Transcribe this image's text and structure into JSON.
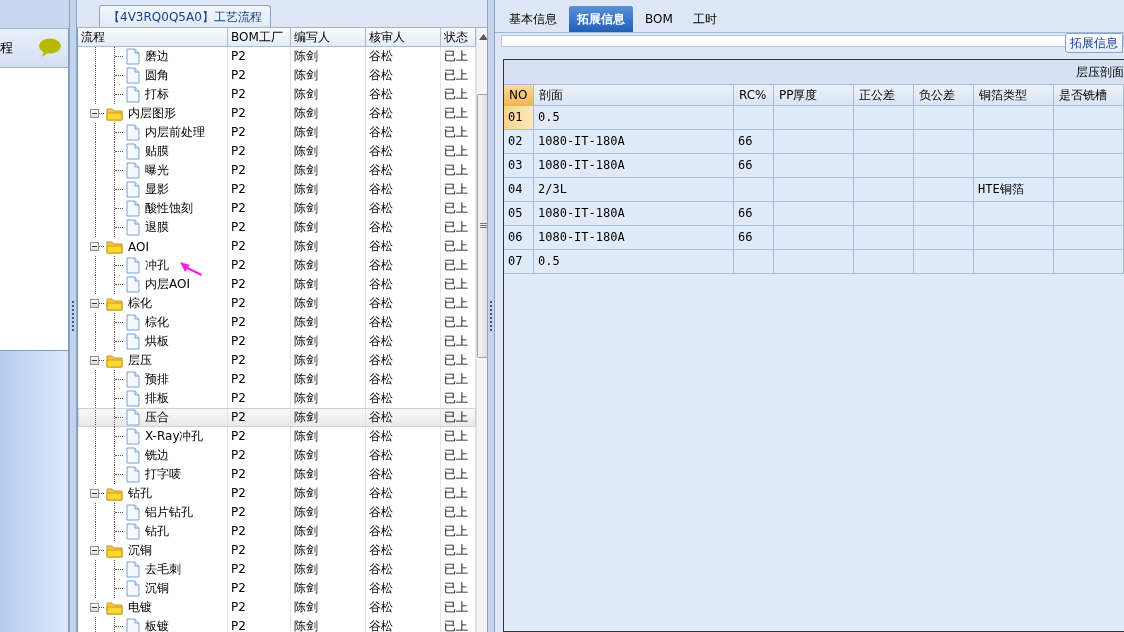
{
  "left_panel": {
    "title": "程"
  },
  "process_panel": {
    "title": "【4V3RQ0Q5A0】工艺流程",
    "columns": [
      "流程",
      "BOM工厂",
      "编写人",
      "核审人",
      "状态"
    ],
    "tree": [
      {
        "children": [
          {
            "name": "磨边",
            "bom": "P2",
            "writer": "陈剑",
            "reviewer": "谷松",
            "status": "已上",
            "selected": false
          },
          {
            "name": "圆角",
            "bom": "P2",
            "writer": "陈剑",
            "reviewer": "谷松",
            "status": "已上",
            "selected": false
          },
          {
            "name": "打标",
            "bom": "P2",
            "writer": "陈剑",
            "reviewer": "谷松",
            "status": "已上",
            "selected": false
          }
        ]
      },
      {
        "name": "内层图形",
        "bom": "P2",
        "writer": "陈剑",
        "reviewer": "谷松",
        "status": "已上",
        "selected": false,
        "expanded": true,
        "children": [
          {
            "name": "内层前处理",
            "bom": "P2",
            "writer": "陈剑",
            "reviewer": "谷松",
            "status": "已上",
            "selected": false
          },
          {
            "name": "贴膜",
            "bom": "P2",
            "writer": "陈剑",
            "reviewer": "谷松",
            "status": "已上",
            "selected": false
          },
          {
            "name": "曝光",
            "bom": "P2",
            "writer": "陈剑",
            "reviewer": "谷松",
            "status": "已上",
            "selected": false
          },
          {
            "name": "显影",
            "bom": "P2",
            "writer": "陈剑",
            "reviewer": "谷松",
            "status": "已上",
            "selected": false
          },
          {
            "name": "酸性蚀刻",
            "bom": "P2",
            "writer": "陈剑",
            "reviewer": "谷松",
            "status": "已上",
            "selected": false
          },
          {
            "name": "退膜",
            "bom": "P2",
            "writer": "陈剑",
            "reviewer": "谷松",
            "status": "已上",
            "selected": false
          }
        ]
      },
      {
        "name": "AOI",
        "bom": "P2",
        "writer": "陈剑",
        "reviewer": "谷松",
        "status": "已上",
        "selected": false,
        "expanded": true,
        "children": [
          {
            "name": "冲孔",
            "bom": "P2",
            "writer": "陈剑",
            "reviewer": "谷松",
            "status": "已上",
            "selected": false
          },
          {
            "name": "内层AOI",
            "bom": "P2",
            "writer": "陈剑",
            "reviewer": "谷松",
            "status": "已上",
            "selected": false
          }
        ]
      },
      {
        "name": "棕化",
        "bom": "P2",
        "writer": "陈剑",
        "reviewer": "谷松",
        "status": "已上",
        "selected": false,
        "expanded": true,
        "children": [
          {
            "name": "棕化",
            "bom": "P2",
            "writer": "陈剑",
            "reviewer": "谷松",
            "status": "已上",
            "selected": false
          },
          {
            "name": "烘板",
            "bom": "P2",
            "writer": "陈剑",
            "reviewer": "谷松",
            "status": "已上",
            "selected": false
          }
        ]
      },
      {
        "name": "层压",
        "bom": "P2",
        "writer": "陈剑",
        "reviewer": "谷松",
        "status": "已上",
        "selected": false,
        "expanded": true,
        "children": [
          {
            "name": "预排",
            "bom": "P2",
            "writer": "陈剑",
            "reviewer": "谷松",
            "status": "已上",
            "selected": false
          },
          {
            "name": "排板",
            "bom": "P2",
            "writer": "陈剑",
            "reviewer": "谷松",
            "status": "已上",
            "selected": false
          },
          {
            "name": "压合",
            "bom": "P2",
            "writer": "陈剑",
            "reviewer": "谷松",
            "status": "已上",
            "selected": true
          },
          {
            "name": "X-Ray冲孔",
            "bom": "P2",
            "writer": "陈剑",
            "reviewer": "谷松",
            "status": "已上",
            "selected": false
          },
          {
            "name": "铣边",
            "bom": "P2",
            "writer": "陈剑",
            "reviewer": "谷松",
            "status": "已上",
            "selected": false
          },
          {
            "name": "打字唛",
            "bom": "P2",
            "writer": "陈剑",
            "reviewer": "谷松",
            "status": "已上",
            "selected": false
          }
        ]
      },
      {
        "name": "钻孔",
        "bom": "P2",
        "writer": "陈剑",
        "reviewer": "谷松",
        "status": "已上",
        "selected": false,
        "expanded": true,
        "children": [
          {
            "name": "铝片钻孔",
            "bom": "P2",
            "writer": "陈剑",
            "reviewer": "谷松",
            "status": "已上",
            "selected": false
          },
          {
            "name": "钻孔",
            "bom": "P2",
            "writer": "陈剑",
            "reviewer": "谷松",
            "status": "已上",
            "selected": false
          }
        ]
      },
      {
        "name": "沉铜",
        "bom": "P2",
        "writer": "陈剑",
        "reviewer": "谷松",
        "status": "已上",
        "selected": false,
        "expanded": true,
        "children": [
          {
            "name": "去毛刺",
            "bom": "P2",
            "writer": "陈剑",
            "reviewer": "谷松",
            "status": "已上",
            "selected": false
          },
          {
            "name": "沉铜",
            "bom": "P2",
            "writer": "陈剑",
            "reviewer": "谷松",
            "status": "已上",
            "selected": false
          }
        ]
      },
      {
        "name": "电镀",
        "bom": "P2",
        "writer": "陈剑",
        "reviewer": "谷松",
        "status": "已上",
        "selected": false,
        "expanded": true,
        "children": [
          {
            "name": "板镀",
            "bom": "P2",
            "writer": "陈剑",
            "reviewer": "谷松",
            "status": "已上",
            "selected": false
          }
        ]
      }
    ]
  },
  "detail": {
    "tabs": [
      {
        "label": "基本信息",
        "selected": false
      },
      {
        "label": "拓展信息",
        "selected": true
      },
      {
        "label": "BOM",
        "selected": false
      },
      {
        "label": "工时",
        "selected": false
      }
    ],
    "section_button": "拓展信息",
    "table": {
      "title": "层压剖面",
      "columns": [
        "NO",
        "剖面",
        "RC%",
        "PP厚度",
        "正公差",
        "负公差",
        "铜箔类型",
        "是否铣槽"
      ],
      "rows": [
        {
          "cells": [
            "01",
            "0.5",
            null,
            null,
            null,
            null,
            null,
            null
          ],
          "selected": true
        },
        {
          "cells": [
            "02",
            "1080-IT-180A",
            "66",
            null,
            null,
            null,
            null,
            null
          ],
          "selected": false
        },
        {
          "cells": [
            "03",
            "1080-IT-180A",
            "66",
            null,
            null,
            null,
            null,
            null
          ],
          "selected": false
        },
        {
          "cells": [
            "04",
            "2/3L",
            null,
            null,
            null,
            null,
            "HTE铜箔",
            null
          ],
          "selected": false
        },
        {
          "cells": [
            "05",
            "1080-IT-180A",
            "66",
            null,
            null,
            null,
            null,
            null
          ],
          "selected": false
        },
        {
          "cells": [
            "06",
            "1080-IT-180A",
            "66",
            null,
            null,
            null,
            null,
            null
          ],
          "selected": false
        },
        {
          "cells": [
            "07",
            "0.5",
            null,
            null,
            null,
            null,
            null,
            null
          ],
          "selected": false
        }
      ]
    }
  }
}
